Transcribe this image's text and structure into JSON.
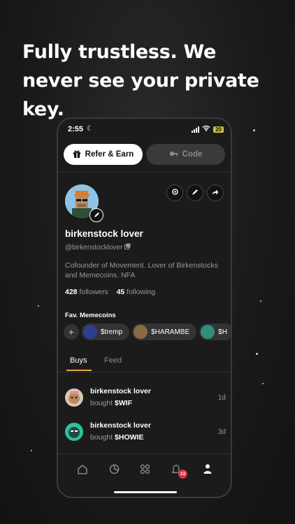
{
  "headline": "Fully trustless. We never see your private key.",
  "status": {
    "time": "2:55",
    "battery": "20"
  },
  "top_buttons": {
    "refer": "Refer & Earn",
    "code": "Code"
  },
  "profile": {
    "name": "birkenstock lover",
    "handle": "@birkenstocklover",
    "bio": "Cofounder of Movement. Lover of Birkenstocks and Memecoins. NFA",
    "followers_count": "428",
    "followers_label": "followers",
    "following_count": "45",
    "following_label": "following"
  },
  "favorites": {
    "label": "Fav. Memecoins",
    "coins": [
      "$tremp",
      "$HARAMBE",
      "$H"
    ]
  },
  "tabs": {
    "buys": "Buys",
    "feed": "Feed"
  },
  "activity": [
    {
      "user": "birkenstock lover",
      "verb": "bought",
      "ticker": "$WIF",
      "time": "1d"
    },
    {
      "user": "birkenstock lover",
      "verb": "bought",
      "ticker": "$HOWIE",
      "time": "3d"
    }
  ],
  "nav": {
    "notification_count": "13"
  },
  "colors": {
    "accent": "#e8a33a",
    "badge": "#e0304b",
    "background": "#1b1b1b"
  }
}
